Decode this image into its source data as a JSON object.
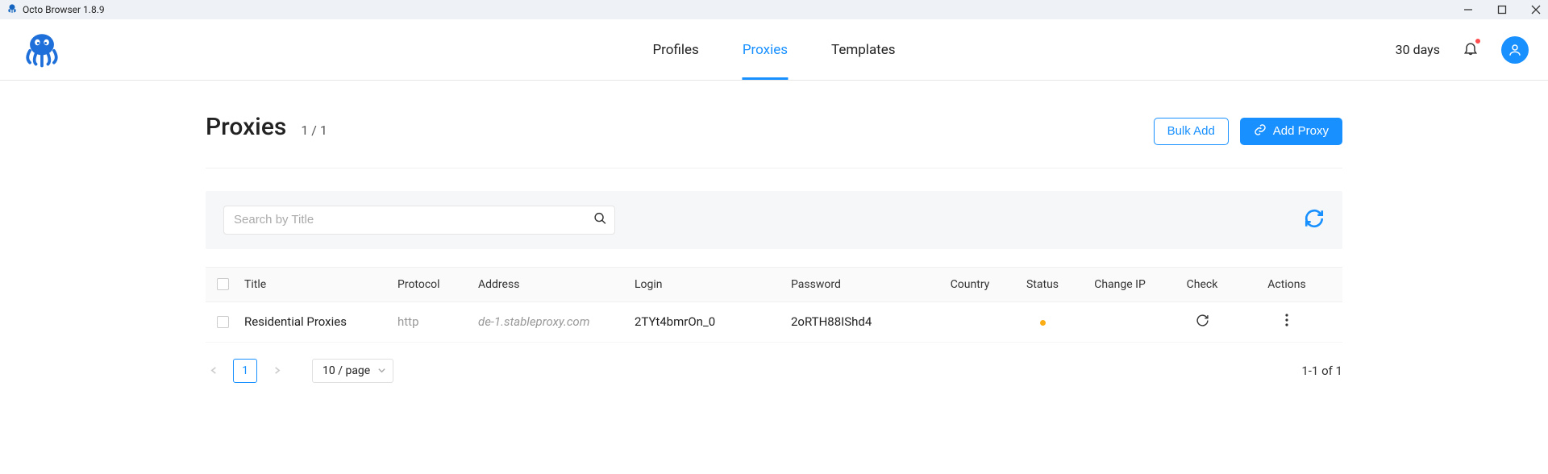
{
  "titlebar": {
    "title": "Octo Browser 1.8.9"
  },
  "nav": {
    "profiles": "Profiles",
    "proxies": "Proxies",
    "templates": "Templates"
  },
  "header": {
    "days": "30 days"
  },
  "page": {
    "title": "Proxies",
    "count": "1 / 1",
    "bulk_add": "Bulk Add",
    "add_proxy": "Add Proxy"
  },
  "search": {
    "placeholder": "Search by Title"
  },
  "columns": {
    "title": "Title",
    "protocol": "Protocol",
    "address": "Address",
    "login": "Login",
    "password": "Password",
    "country": "Country",
    "status": "Status",
    "change_ip": "Change IP",
    "check": "Check",
    "actions": "Actions"
  },
  "rows": [
    {
      "title": "Residential Proxies",
      "protocol": "http",
      "address": "de-1.stableproxy.com",
      "login": "2TYt4bmrOn_0",
      "password": "2oRTH88IShd4"
    }
  ],
  "pagination": {
    "current": "1",
    "size": "10 / page",
    "range": "1-1 of 1"
  }
}
